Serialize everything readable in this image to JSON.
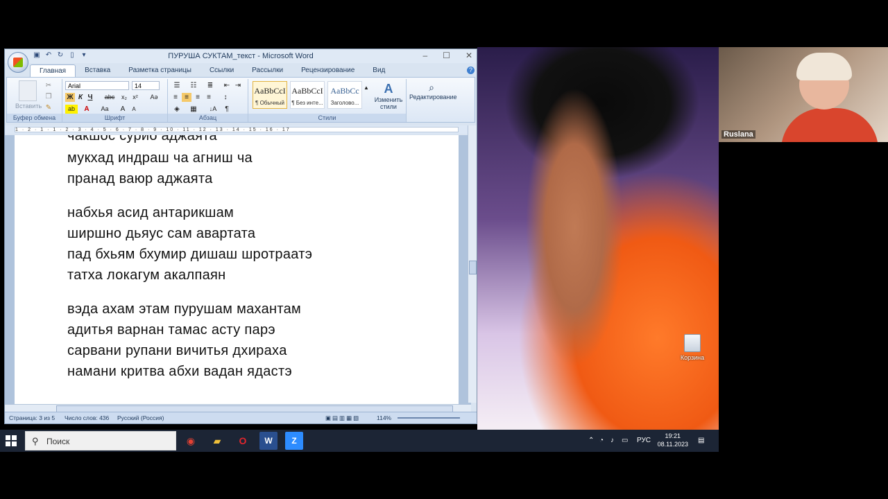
{
  "window": {
    "title": "ПУРУША СУКТАМ_текст - Microsoft Word",
    "controls": [
      "–",
      "☐",
      "✕"
    ]
  },
  "ribbon": {
    "tabs": [
      "Главная",
      "Вставка",
      "Разметка страницы",
      "Ссылки",
      "Рассылки",
      "Рецензирование",
      "Вид"
    ],
    "clipboard": {
      "paste": "Вставить",
      "label": "Буфер обмена"
    },
    "font": {
      "name": "Arial",
      "size": "14",
      "label": "Шрифт"
    },
    "paragraph_label": "Абзац",
    "styles": {
      "label": "Стили",
      "items": [
        {
          "sample": "AaBbCcI",
          "name": "¶ Обычный"
        },
        {
          "sample": "AaBbCcI",
          "name": "¶ Без инте..."
        },
        {
          "sample": "AaBbCc",
          "name": "Заголово..."
        }
      ],
      "change": "Изменить стили"
    },
    "editing": "Редактирование"
  },
  "ruler_text": "1 · 2 · 1 · 1 · 2 · 3 · 4 · 5 · 6 · 7 · 8 · 9 · 10 · 11 · 12 · 13 · 14 · 15 · 16 · 17",
  "document": {
    "lines": [
      "чакшоc сурйо аджаята",
      "мукхад индраш ча агниш ча",
      "пранад ваюр аджаята",
      "набхья асид антарикшам",
      "ширшно дьяус сам авартата",
      "пад бхьям бхумир дишаш шротраатэ",
      "татха локагум акалпаян",
      "вэда ахам этам пурушам махантам",
      "адитья варнан тамас асту парэ",
      "сарвани рупани вичитья дхирахa",
      "намани критва абхи вадан ядастэ"
    ]
  },
  "status": {
    "page": "Страница: 3 из 5",
    "words": "Число слов: 436",
    "language": "Русский (Россия)",
    "zoom": "114%"
  },
  "desktop": {
    "recycle_bin": "Корзина"
  },
  "video": {
    "participant": "Ruslana"
  },
  "taskbar": {
    "search_placeholder": "Поиск",
    "lang": "РУС",
    "time": "19:21",
    "date": "08.11.2023"
  }
}
